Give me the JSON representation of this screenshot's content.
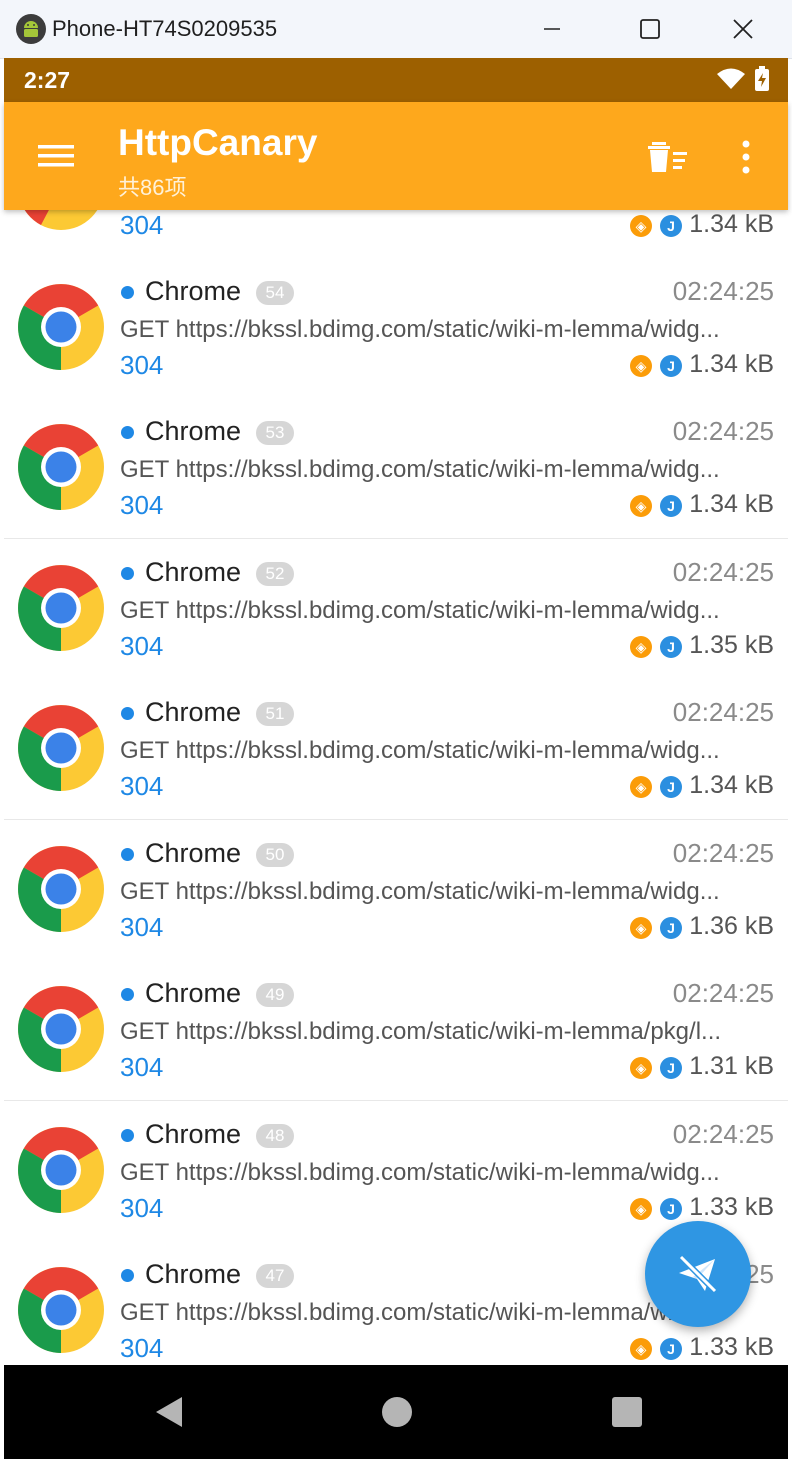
{
  "window": {
    "title": "Phone-HT74S0209535"
  },
  "status_bar": {
    "time": "2:27"
  },
  "app_bar": {
    "title": "HttpCanary",
    "subtitle": "共86项"
  },
  "colors": {
    "app_bar": "#fea81c",
    "status_bar": "#9d6000",
    "accent_blue": "#1e88e5",
    "fab": "#2f96e3"
  },
  "partial_row": {
    "status": "304",
    "size": "1.34 kB"
  },
  "requests": [
    {
      "app": "Chrome",
      "id": "54",
      "time": "02:24:25",
      "url": "GET https://bkssl.bdimg.com/static/wiki-m-lemma/widg...",
      "status": "304",
      "size": "1.34 kB"
    },
    {
      "app": "Chrome",
      "id": "53",
      "time": "02:24:25",
      "url": "GET https://bkssl.bdimg.com/static/wiki-m-lemma/widg...",
      "status": "304",
      "size": "1.34 kB"
    },
    {
      "app": "Chrome",
      "id": "52",
      "time": "02:24:25",
      "url": "GET https://bkssl.bdimg.com/static/wiki-m-lemma/widg...",
      "status": "304",
      "size": "1.35 kB"
    },
    {
      "app": "Chrome",
      "id": "51",
      "time": "02:24:25",
      "url": "GET https://bkssl.bdimg.com/static/wiki-m-lemma/widg...",
      "status": "304",
      "size": "1.34 kB"
    },
    {
      "app": "Chrome",
      "id": "50",
      "time": "02:24:25",
      "url": "GET https://bkssl.bdimg.com/static/wiki-m-lemma/widg...",
      "status": "304",
      "size": "1.36 kB"
    },
    {
      "app": "Chrome",
      "id": "49",
      "time": "02:24:25",
      "url": "GET https://bkssl.bdimg.com/static/wiki-m-lemma/pkg/l...",
      "status": "304",
      "size": "1.31 kB"
    },
    {
      "app": "Chrome",
      "id": "48",
      "time": "02:24:25",
      "url": "GET https://bkssl.bdimg.com/static/wiki-m-lemma/widg...",
      "status": "304",
      "size": "1.33 kB"
    },
    {
      "app": "Chrome",
      "id": "47",
      "time": "02:24:25",
      "url": "GET https://bkssl.bdimg.com/static/wiki-m-lemma/widg...",
      "status": "304",
      "size": "1.33 kB"
    }
  ]
}
